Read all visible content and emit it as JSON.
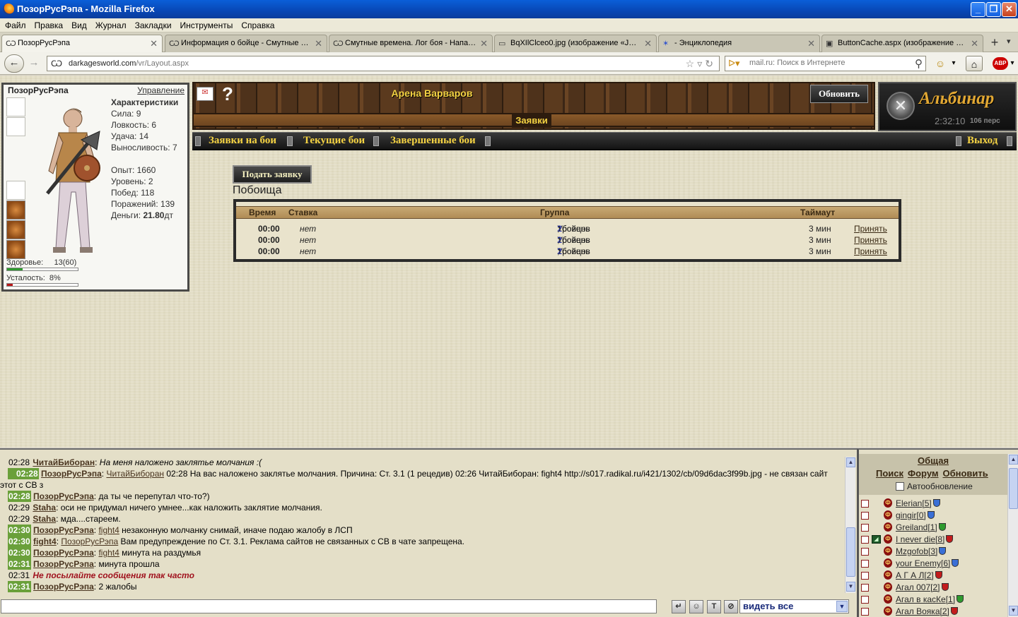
{
  "window": {
    "title": "ПозорРусРэпа - Mozilla Firefox",
    "controls": [
      "_",
      "❐",
      "✕"
    ]
  },
  "menu": [
    "Файл",
    "Правка",
    "Вид",
    "Журнал",
    "Закладки",
    "Инструменты",
    "Справка"
  ],
  "tabs": [
    {
      "label": "ПозорРусРэпа",
      "icon": "site-icon"
    },
    {
      "label": "Информация о бойце - Смутные Вр...",
      "icon": "site-icon"
    },
    {
      "label": "Смутные времена. Лог боя - Напад...",
      "icon": "site-icon"
    },
    {
      "label": "BqXIlClceo0.jpg (изображение «JPE...",
      "icon": "page-icon"
    },
    {
      "label": "- Энциклопедия",
      "icon": "wiki-icon"
    },
    {
      "label": "ButtonCache.aspx (изображение «J...",
      "icon": "image-icon"
    }
  ],
  "navbar": {
    "url_host": "darkagesworld.com",
    "url_path": "/vr/Layout.aspx",
    "search_placeholder": "mail.ru: Поиск в Интернете"
  },
  "character": {
    "name": "ПозорРусРэпа",
    "manage_link": "Управление",
    "stats_header": "Характеристики",
    "stats": [
      "Сила: 9",
      "Ловкость: 6",
      "Удача: 14",
      "Выносливость: 7"
    ],
    "progress": [
      "Опыт: 1660",
      "Уровень: 2",
      "Побед: 118",
      "Поражений: 139"
    ],
    "money_label": "Деньги:",
    "money_value": "21.80",
    "money_unit": "дт",
    "health_label": "Здоровье:",
    "health_value": "13(60)",
    "health_fraction": 0.217,
    "health_color": "#2e9a2e",
    "fatigue_label": "Усталость:",
    "fatigue_value": "8%",
    "fatigue_fraction": 0.08,
    "fatigue_color": "#b81818"
  },
  "header": {
    "arena_title": "Арена Варваров",
    "section": "Заявки",
    "refresh_button": "Обновить",
    "help_icon": "?"
  },
  "logo": {
    "name": "Альбинар",
    "time": "2:32:10",
    "online": "106 перс"
  },
  "nav": {
    "items": [
      "Заявки на бои",
      "Текущие бои",
      "Завершенные бои"
    ],
    "exit": "Выход"
  },
  "main": {
    "submit_button": "Подать заявку",
    "section_title": "Побоища",
    "table": {
      "headers": {
        "time": "Время",
        "stake": "Ставка",
        "group": "Группа",
        "timeout": "Таймаут"
      },
      "rows": [
        {
          "time": "00:00",
          "stake": "нет",
          "group_prefix": "Уровень",
          "level": "2",
          "fighters_label": ", бойцов",
          "fighters": "1",
          "timeout": "3 мин",
          "action": "Принять"
        },
        {
          "time": "00:00",
          "stake": "нет",
          "group_prefix": "Уровень",
          "level": "2",
          "fighters_label": ", бойцов",
          "fighters": "1",
          "timeout": "3 мин",
          "action": "Принять"
        },
        {
          "time": "00:00",
          "stake": "нет",
          "group_prefix": "Уровень",
          "level": "2",
          "fighters_label": ", бойцов",
          "fighters": "1",
          "timeout": "3 мин",
          "action": "Принять"
        }
      ]
    }
  },
  "chat": {
    "messages": [
      {
        "time": "02:28",
        "hl": false,
        "nick": "ЧитайБиборан",
        "sep": ":",
        "to": "",
        "text": "На меня наложено заклятье молчания :(",
        "style": "it"
      },
      {
        "time": "02:28",
        "hl": true,
        "nick": "ПозорРусРэпа",
        "sep": ":",
        "to": "ЧитайБиборан",
        "text": "02:28 На вас наложено заклятье молчания. Причина: Ст. 3.1 (1 рецедив) 02:26 ЧитайБиборан: fight4 http://s017.radikal.ru/i421/1302/cb/09d6dac3f99b.jpg - не связан сайт этот с СВ з",
        "style": ""
      },
      {
        "time": "02:28",
        "hl": true,
        "nick": "ПозорРусРэпа",
        "sep": ":",
        "to": "",
        "text": "да ты че перепутал что-то?)",
        "style": ""
      },
      {
        "time": "02:29",
        "hl": false,
        "nick": "Staha",
        "sep": ":",
        "to": "",
        "text": "оси не придумал ничего умнее...как наложить заклятие молчания.",
        "style": ""
      },
      {
        "time": "02:29",
        "hl": false,
        "nick": "Staha",
        "sep": ":",
        "to": "",
        "text": "мда....стареем.",
        "style": ""
      },
      {
        "time": "02:30",
        "hl": true,
        "nick": "ПозорРусРэпа",
        "sep": ":",
        "to": "fight4",
        "text": "незаконную молчанку снимай, иначе подаю жалобу в ЛСП",
        "style": ""
      },
      {
        "time": "02:30",
        "hl": true,
        "nick": "fight4",
        "sep": ":",
        "to": "ПозорРусРэпа",
        "text": "Вам предупреждение по Ст. 3.1. Реклама сайтов не связанных с СВ в чате запрещена.",
        "style": ""
      },
      {
        "time": "02:30",
        "hl": true,
        "nick": "ПозорРусРэпа",
        "sep": ":",
        "to": "fight4",
        "text": "минута на раздумья",
        "style": ""
      },
      {
        "time": "02:31",
        "hl": true,
        "nick": "ПозорРусРэпа",
        "sep": ":",
        "to": "",
        "text": "минута прошла",
        "style": ""
      },
      {
        "time": "02:31",
        "hl": false,
        "nick": "",
        "sep": "",
        "to": "",
        "text": "Не посылайте сообщения так часто",
        "style": "sys"
      },
      {
        "time": "02:31",
        "hl": true,
        "nick": "ПозорРусРэпа",
        "sep": ":",
        "to": "",
        "text": "2 жалобы",
        "style": ""
      }
    ],
    "input_value": "",
    "buttons": [
      "↵",
      "☺",
      "T",
      "⊘"
    ],
    "filter_value": "видеть все"
  },
  "users": {
    "title": "Общая",
    "links": [
      "Поиск",
      "Форум",
      "Обновить"
    ],
    "autorefresh": "Автообновление",
    "list": [
      {
        "name": "Elerian",
        "level": "[5]",
        "shield": "#3a6fd6",
        "guild": false
      },
      {
        "name": "gingir",
        "level": "[0]",
        "shield": "#3a6fd6",
        "guild": false
      },
      {
        "name": "Greiland",
        "level": "[1]",
        "shield": "#2e9a2e",
        "guild": false
      },
      {
        "name": "I never die",
        "level": "[8]",
        "shield": "#c21c1c",
        "guild": true
      },
      {
        "name": "Mzgofob",
        "level": "[3]",
        "shield": "#3a6fd6",
        "guild": false
      },
      {
        "name": "your Enemy",
        "level": "[6]",
        "shield": "#3a6fd6",
        "guild": false
      },
      {
        "name": "А Г А Л",
        "level": "[2]",
        "shield": "#c21c1c",
        "guild": false
      },
      {
        "name": "Агал 007",
        "level": "[2]",
        "shield": "#c21c1c",
        "guild": false
      },
      {
        "name": "Агал в касКе",
        "level": "[1]",
        "shield": "#2e9a2e",
        "guild": false
      },
      {
        "name": "Агал Вояка",
        "level": "[2]",
        "shield": "#c21c1c",
        "guild": false
      }
    ]
  }
}
